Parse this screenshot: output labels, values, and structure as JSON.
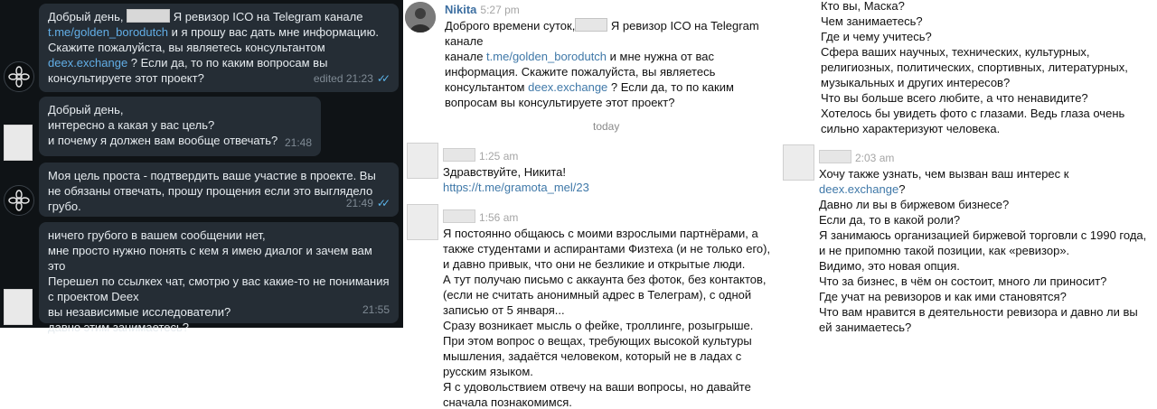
{
  "dark_chat": {
    "messages": [
      {
        "pre": "Добрый день, ",
        "text1": " Я ревизор ICO на Telegram канале",
        "link1": "t.me/golden_borodutch",
        "text2": " и я прошу вас дать мне информацию. Скажите пожалуйста, вы являетесь консультантом",
        "link2": "deex.exchange",
        "text3": " ? Если да, то по каким вопросам вы консультируете этот проект?",
        "time": "edited 21:23"
      },
      {
        "text": "Добрый день,\nинтересно а какая у вас цель?\nи почему я должен вам вообще отвечать?",
        "time": "21:48"
      },
      {
        "text": "Моя цель проста - подтвердить ваше участие в проекте. Вы не обязаны отвечать, прошу прощения если это выглядело грубо.",
        "time": "21:49"
      },
      {
        "text": "ничего грубого в вашем сообщении нет,\nмне просто нужно понять с кем я имею диалог и зачем вам это\nПерешел по ссылкех чат, смотрю у вас какие-то не понимания с проектом Deex\nвы независимые исследователи?\nдавно этим занимаетесь?",
        "time": "21:55"
      }
    ]
  },
  "light_chat": {
    "first": {
      "name": "Nikita",
      "time": "5:27 pm",
      "pre": "Доброго времени суток,",
      "text1": " Я ревизор ICO на Telegram канале ",
      "link1": "t.me/golden_borodutch",
      "text2": " и мне нужна от вас информация. Скажите пожалуйста, вы являетесь консультантом ",
      "link2": "deex.exchange",
      "text3": " ? Если да, то по каким вопросам вы консультируете этот проект?"
    },
    "divider": "today",
    "msg2": {
      "time": "1:25 am",
      "text": "Здравствуйте, Никита!",
      "link": "https://t.me/gramota_mel/23"
    },
    "msg3": {
      "time": "1:56 am",
      "text": "Я постоянно общаюсь с моими взрослыми партнёрами, а также студентами и аспирантами Физтеха (и не только его), и давно привык, что они не безликие и открытые люди.\nА тут получаю письмо с аккаунта без фоток, без контактов, (если не считать анонимный адрес в Телеграм), с одной записью от 5 января...\nСразу возникает мысль о фейке, троллинге, розыгрыше.\nПри этом вопрос о вещах, требующих высокой культуры мышления, задаётся человеком, который не в ладах с русским языком.\nЯ с удовольствием отвечу на ваши вопросы, но давайте сначала познакомимся."
    }
  },
  "right_chat": {
    "top_text": "Кто вы, Маска?\nЧем занимаетесь?\nГде и чему учитесь?\nСфера ваших научных, технических, культурных, религиозных, политических, спортивных, литературных, музыкальных и других интересов?\nЧто вы больше всего любите, а что ненавидите?\nХотелось бы увидеть фото с глазами. Ведь глаза очень сильно характеризуют человека.",
    "msg": {
      "time": "2:03 am",
      "pre": "Хочу также узнать, чем вызван ваш интерес к ",
      "link": "deex.exchange",
      "post": "?",
      "text": "Давно ли вы в биржевом бизнесе?\nЕсли да, то в какой роли?\nЯ занимаюсь организацией биржевой торговли с 1990 года, и не припомню такой позиции, как «ревизор».\nВидимо, это новая опция.\nЧто за бизнес, в чём он состоит, много ли приносит?\nГде учат на ревизоров и как ими становятся?\nЧто вам нравится в деятельности ревизора и давно ли вы ей занимаетесь?"
    }
  }
}
